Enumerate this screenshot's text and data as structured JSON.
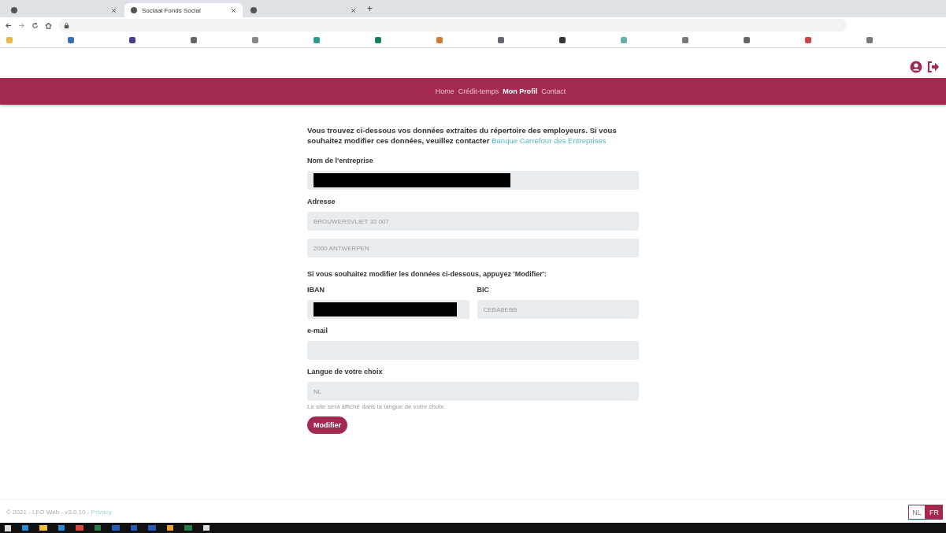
{
  "browser": {
    "tabs": [
      {
        "selected": false
      },
      {
        "title": "Sociaal Fonds Social",
        "selected": true
      },
      {
        "selected": false
      }
    ],
    "new_tab": "+"
  },
  "nav": [
    {
      "label": "Home",
      "selected": false
    },
    {
      "label": "Crédit-temps",
      "selected": false
    },
    {
      "label": "Mon Profil",
      "selected": true
    },
    {
      "label": "Contact",
      "selected": false
    }
  ],
  "intro": "Vous trouvez ci-dessous vos données extraites du répertoire des employeurs. Si vous souhaitez modifier ces données, veuillez contacter ",
  "intro_link": "Banque Carrefour des Entreprises",
  "company": {
    "label": "Nom de l'entreprise",
    "redacted": true
  },
  "address": {
    "label": "Adresse",
    "lines": [
      "BROUWERSVLIET 33 007",
      "2000 ANTWERPEN"
    ]
  },
  "edit_note": "Si vous souhaitez modifier les données ci-dessous, appuyez 'Modifier':",
  "iban": {
    "label": "IBAN",
    "redacted": true
  },
  "bic": {
    "label": "BIC",
    "value": "CEBABEBB"
  },
  "email": {
    "label": "e-mail"
  },
  "language": {
    "label": "Langue de votre choix",
    "value": "NL",
    "hint": "Le site sera affiché dans la langue de votre choix."
  },
  "submit": "Modifier",
  "footer": {
    "text": "© 2021 - LFO Web - v3.0.10 - ",
    "link": "Privacy"
  },
  "languages": [
    {
      "label": "NL",
      "selected": false
    },
    {
      "label": "FR",
      "selected": true
    }
  ]
}
